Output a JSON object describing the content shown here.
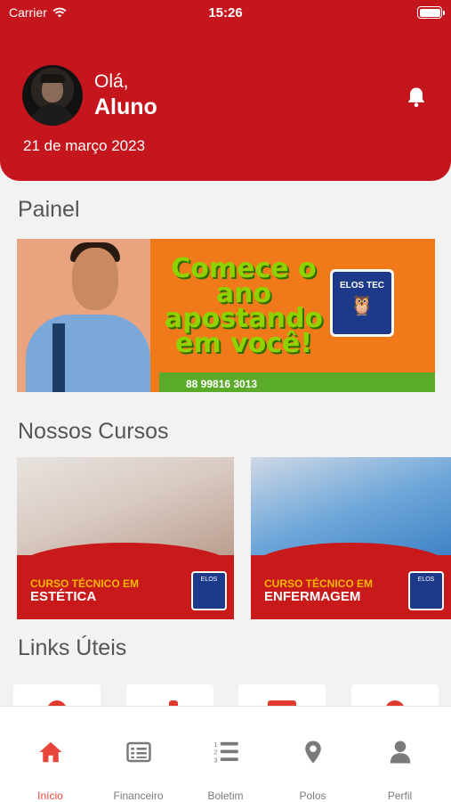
{
  "status_bar": {
    "carrier": "Carrier",
    "time": "15:26"
  },
  "header": {
    "greeting": "Olá,",
    "user_name": "Aluno",
    "date": "21 de março 2023"
  },
  "sections": {
    "panel_title": "Painel",
    "courses_title": "Nossos Cursos",
    "links_title": "Links Úteis"
  },
  "banner": {
    "headline": "Comece o ano apostando em você!",
    "logo_text": "ELOS TEC",
    "phone_fragment": "88 99816 3013"
  },
  "courses": [
    {
      "kicker": "CURSO TÉCNICO EM",
      "name": "ESTÉTICA",
      "badge": "ELOS"
    },
    {
      "kicker": "CURSO TÉCNICO EM",
      "name": "ENFERMAGEM",
      "badge": "ELOS"
    }
  ],
  "tabs": [
    {
      "label": "Início",
      "icon": "home-icon",
      "active": true
    },
    {
      "label": "Financeiro",
      "icon": "invoice-icon",
      "active": false
    },
    {
      "label": "Boletim",
      "icon": "numbered-list-icon",
      "active": false
    },
    {
      "label": "Polos",
      "icon": "location-pin-icon",
      "active": false
    },
    {
      "label": "Perfil",
      "icon": "user-icon",
      "active": false
    }
  ],
  "colors": {
    "brand_red": "#c4161c",
    "tab_active": "#e8463a",
    "tab_inactive": "#7a7a7a"
  }
}
